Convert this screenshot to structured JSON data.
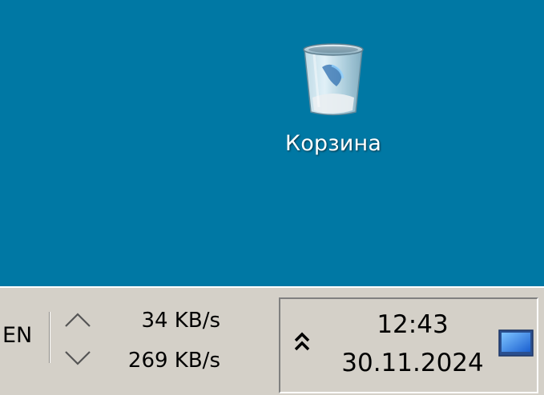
{
  "desktop": {
    "background": "#0078a4",
    "icons": [
      {
        "label": "Корзина",
        "icon": "recycle-bin-icon"
      }
    ]
  },
  "taskbar": {
    "background": "#d4d0c8",
    "language": "EN",
    "network": {
      "upload_rate": "34 KB/s",
      "download_rate": "269 KB/s",
      "upload_icon": "chevron-up-icon",
      "download_icon": "chevron-down-icon"
    },
    "tray": {
      "expand_icon": "double-chevron-up-icon",
      "time": "12:43",
      "date": "30.11.2024",
      "show_desktop_icon": "monitor-icon"
    }
  }
}
